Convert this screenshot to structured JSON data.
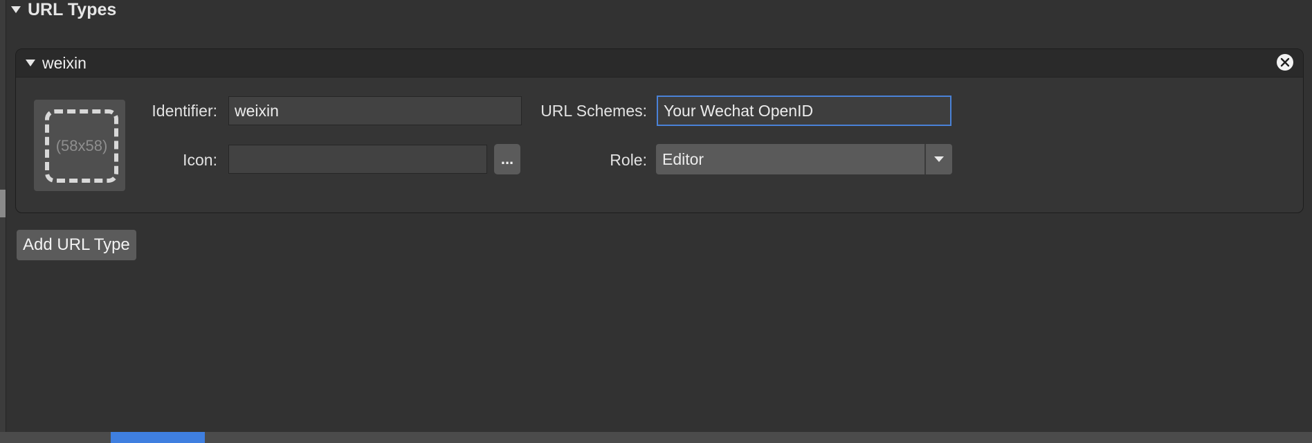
{
  "section": {
    "title": "URL Types"
  },
  "url_type": {
    "name": "weixin",
    "icon_placeholder": "(58x58)",
    "identifier_label": "Identifier:",
    "identifier_value": "weixin",
    "icon_label": "Icon:",
    "icon_value": "",
    "browse_label": "...",
    "url_schemes_label": "URL Schemes:",
    "url_schemes_value": "Your Wechat OpenID",
    "role_label": "Role:",
    "role_value": "Editor"
  },
  "actions": {
    "add_label": "Add URL Type"
  },
  "icons": {
    "section_disclosure": "disclosure-triangle-icon",
    "item_disclosure": "disclosure-triangle-icon",
    "close": "close-circle-icon",
    "dropdown": "chevron-down-icon"
  },
  "colors": {
    "background": "#323232",
    "focus_ring": "#4a82d8",
    "selected_tab": "#3f7fe0"
  }
}
